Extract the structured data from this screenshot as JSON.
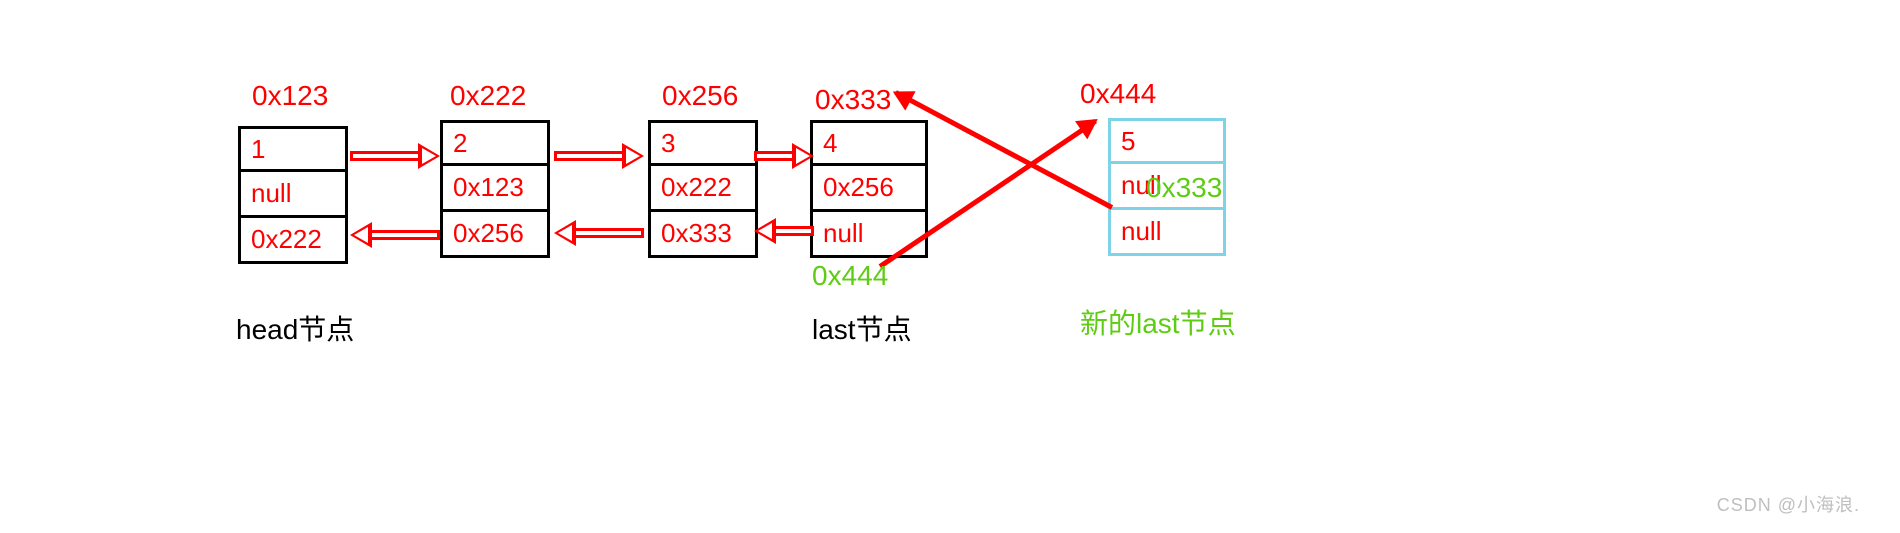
{
  "addresses": {
    "n1": "0x123",
    "n2": "0x222",
    "n3": "0x256",
    "n4": "0x333",
    "n5": "0x444"
  },
  "nodes": {
    "n1": {
      "val": "1",
      "prev": "null",
      "next": "0x222"
    },
    "n2": {
      "val": "2",
      "prev": "0x123",
      "next": "0x256"
    },
    "n3": {
      "val": "3",
      "prev": "0x222",
      "next": "0x333"
    },
    "n4": {
      "val": "4",
      "prev": "0x256",
      "next": "null"
    },
    "n5": {
      "val": "5",
      "prev": "null",
      "next": "null"
    }
  },
  "overlays": {
    "n4_next_new": "0x444",
    "n5_prev_new": "0x333"
  },
  "captions": {
    "head": "head节点",
    "last": "last节点",
    "newlast": "新的last节点"
  },
  "watermark": "CSDN @小海浪."
}
